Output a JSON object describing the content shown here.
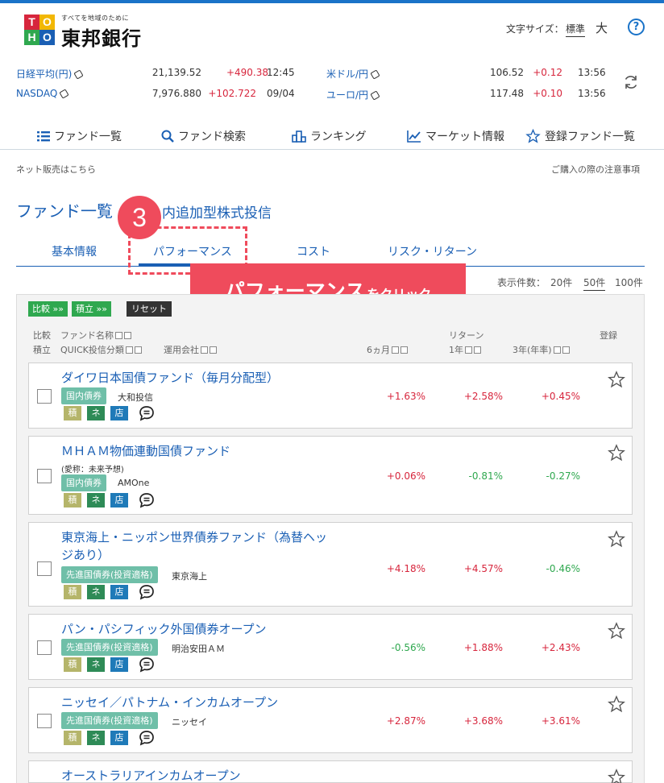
{
  "header": {
    "bank_tagline": "すべてを地域のために",
    "bank_name": "東邦銀行",
    "logo_letters": [
      "T",
      "O",
      "H",
      "O"
    ],
    "font_size_label": "文字サイズ：",
    "font_size_standard": "標準",
    "font_size_large": "大",
    "help_label": "?"
  },
  "market": {
    "rows": [
      {
        "name": "日経平均(円)",
        "value": "21,139.52",
        "change": "+490.38",
        "time": "12:45"
      },
      {
        "name": "NASDAQ",
        "value": "7,976.880",
        "change": "+102.722",
        "time": "09/04"
      },
      {
        "name": "米ドル/円",
        "value": "106.52",
        "change": "+0.12",
        "time": "13:56"
      },
      {
        "name": "ユーロ/円",
        "value": "117.48",
        "change": "+0.10",
        "time": "13:56"
      }
    ]
  },
  "nav": {
    "items": [
      "ファンド一覧",
      "ファンド検索",
      "ランキング",
      "マーケット情報",
      "登録ファンド一覧"
    ]
  },
  "links": {
    "net_sales": "ネット販売はこちら",
    "purchase_notes": "ご購入の際の注意事項"
  },
  "page": {
    "title": "ファンド一覧",
    "subtitle": "内追加型株式投信"
  },
  "tabs": [
    "基本情報",
    "パフォーマンス",
    "コスト",
    "リスク・リターン"
  ],
  "annotation": {
    "step": "3",
    "callout_main": "パフォーマンス",
    "callout_suffix": "をクリック"
  },
  "display_count": {
    "label": "表示件数：",
    "options": [
      "20件",
      "50件",
      "100件"
    ],
    "selected": "50件"
  },
  "list": {
    "compare_btn": "比較 »»",
    "accumulate_btn": "積立 »»",
    "reset_btn": "リセット",
    "headers": {
      "compare": "比較",
      "fund_name": "ファンド名称",
      "accumulate": "積立",
      "quick_class": "QUICK投信分類",
      "company": "運用会社",
      "returns": "リターン",
      "m6": "6ヵ月",
      "y1": "1年",
      "y3": "3年(年率)",
      "register": "登録"
    },
    "tags": [
      "積",
      "ネ",
      "店"
    ],
    "funds": [
      {
        "name_line1": "ダイワ日本国債ファンド（毎月分配型）",
        "name_line2": "",
        "nickname": "",
        "category": "国内債券",
        "company": "大和投信",
        "m6": "+1.63%",
        "y1": "+2.58%",
        "y3": "+0.45%"
      },
      {
        "name_line1": "ＭＨＡＭ物価連動国債ファンド",
        "name_line2": "",
        "nickname": "(愛称：未来予想)",
        "category": "国内債券",
        "company": "AMOne",
        "m6": "+0.06%",
        "y1": "-0.81%",
        "y3": "-0.27%"
      },
      {
        "name_line1": "東京海上・ニッポン世界債券ファンド（為替ヘッ",
        "name_line2": "ジあり）",
        "nickname": "",
        "category": "先進国債券(投資適格)",
        "company": "東京海上",
        "m6": "+4.18%",
        "y1": "+4.57%",
        "y3": "-0.46%"
      },
      {
        "name_line1": "パン・パシフィック外国債券オープン",
        "name_line2": "",
        "nickname": "",
        "category": "先進国債券(投資適格)",
        "company": "明治安田ＡＭ",
        "m6": "-0.56%",
        "y1": "+1.88%",
        "y3": "+2.43%"
      },
      {
        "name_line1": "ニッセイ／パトナム・インカムオープン",
        "name_line2": "",
        "nickname": "",
        "category": "先進国債券(投資適格)",
        "company": "ニッセイ",
        "m6": "+2.87%",
        "y1": "+3.68%",
        "y3": "+3.61%"
      },
      {
        "name_line1": "オーストラリアインカムオープン",
        "name_line2": "",
        "nickname": "",
        "category": "",
        "company": "",
        "m6": "",
        "y1": "",
        "y3": ""
      }
    ]
  },
  "colors": {
    "accent_blue": "#1a5fb4",
    "highlight_red": "#ef4b5c",
    "positive": "#d7263d",
    "negative": "#2fa84f"
  }
}
